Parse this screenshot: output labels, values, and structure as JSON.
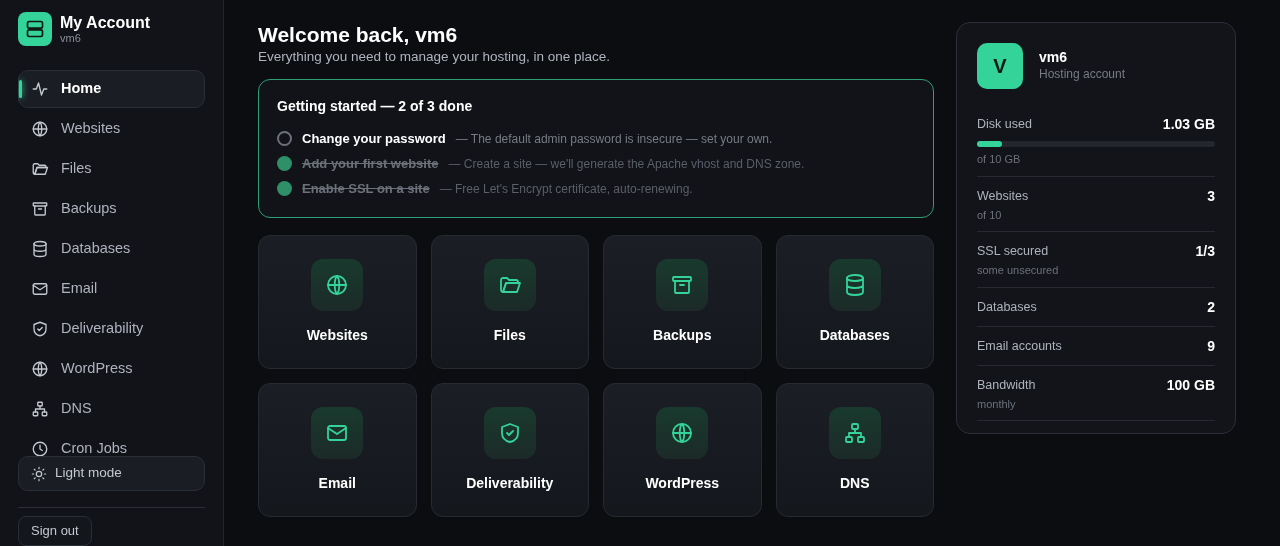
{
  "brand": {
    "title": "My Account",
    "subtitle": "vm6"
  },
  "nav": [
    {
      "label": "Home",
      "selected": true
    },
    {
      "label": "Websites",
      "selected": false
    },
    {
      "label": "Files",
      "selected": false
    },
    {
      "label": "Backups",
      "selected": false
    },
    {
      "label": "Databases",
      "selected": false
    },
    {
      "label": "Email",
      "selected": false
    },
    {
      "label": "Deliverability",
      "selected": false
    },
    {
      "label": "WordPress",
      "selected": false
    },
    {
      "label": "DNS",
      "selected": false
    },
    {
      "label": "Cron Jobs",
      "selected": false
    }
  ],
  "theme_button": "Light mode",
  "signout_button": "Sign out",
  "heading": "Welcome back, vm6",
  "subheading": "Everything you need to manage your hosting, in one place.",
  "checklist": {
    "title": "Getting started — 2 of 3 done",
    "items": [
      {
        "title": "Change your password",
        "note": "— The default admin password is insecure — set your own.",
        "done": false
      },
      {
        "title": "Add your first website",
        "note": "— Create a site — we'll generate the Apache vhost and DNS zone.",
        "done": true
      },
      {
        "title": "Enable SSL on a site",
        "note": "— Free Let's Encrypt certificate, auto-renewing.",
        "done": true
      }
    ]
  },
  "tiles": [
    "Websites",
    "Files",
    "Backups",
    "Databases",
    "Email",
    "Deliverability",
    "WordPress",
    "DNS"
  ],
  "account": {
    "initial": "V",
    "name": "vm6",
    "type": "Hosting account",
    "stats": [
      {
        "label": "Disk used",
        "value": "1.03 GB",
        "level": 0.103,
        "sub": "of 10 GB"
      },
      {
        "label": "Websites",
        "value": "3",
        "sub": "of 10"
      },
      {
        "label": "SSL secured",
        "value": "1/3",
        "sub": "some unsecured"
      },
      {
        "label": "Databases",
        "value": "2"
      },
      {
        "label": "Email accounts",
        "value": "9"
      },
      {
        "label": "Bandwidth",
        "value": "100 GB",
        "sub": "monthly"
      }
    ]
  }
}
